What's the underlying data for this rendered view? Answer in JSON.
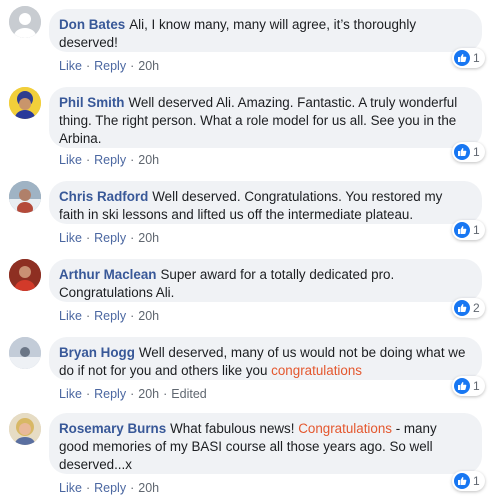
{
  "colors": {
    "author": "#385898",
    "highlight": "#e4572e",
    "bubble": "#f0f2f5",
    "like_blue": "#1877f2"
  },
  "actions": {
    "like": "Like",
    "reply": "Reply",
    "dot": "·"
  },
  "comments": [
    {
      "author": "Don Bates",
      "text_before": "Ali, I know many, many will agree, it’s thoroughly deserved!",
      "highlight": "",
      "text_after": "",
      "time": "20h",
      "edited": "",
      "reaction_icon": "like-icon",
      "reactions": "1"
    },
    {
      "author": "Phil Smith",
      "text_before": "Well deserved Ali. Amazing. Fantastic. A truly wonderful thing. The right person. What a role model for us all. See you in the Arbina.",
      "highlight": "",
      "text_after": "",
      "time": "20h",
      "edited": "",
      "reaction_icon": "like-icon",
      "reactions": "1"
    },
    {
      "author": "Chris Radford",
      "text_before": "Well deserved. Congratulations. You restored my faith in ski lessons and lifted us off the intermediate plateau.",
      "highlight": "",
      "text_after": "",
      "time": "20h",
      "edited": "",
      "reaction_icon": "like-icon",
      "reactions": "1"
    },
    {
      "author": "Arthur Maclean",
      "text_before": "Super award for a totally dedicated pro. Congratulations Ali.",
      "highlight": "",
      "text_after": "",
      "time": "20h",
      "edited": "",
      "reaction_icon": "like-icon",
      "reactions": "2"
    },
    {
      "author": "Bryan Hogg",
      "text_before": "Well deserved, many of us would not be doing what we do if not for you and others like you ",
      "highlight": "congratulations",
      "text_after": "",
      "time": "20h",
      "edited": "Edited",
      "reaction_icon": "like-icon",
      "reactions": "1"
    },
    {
      "author": "Rosemary Burns",
      "text_before": "What fabulous news! ",
      "highlight": "Congratulations",
      "text_after": " - many good memories of my BASI course all those years ago. So well deserved...x",
      "time": "20h",
      "edited": "",
      "reaction_icon": "like-icon",
      "reactions": "1"
    }
  ]
}
